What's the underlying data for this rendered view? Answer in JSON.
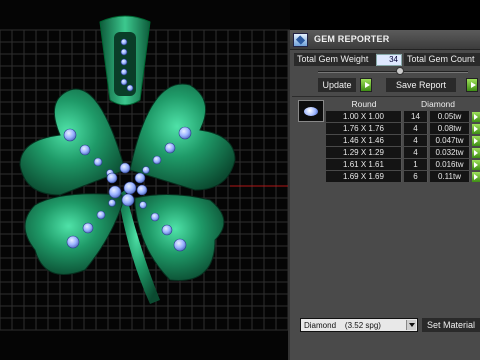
{
  "panel": {
    "title": "GEM REPORTER",
    "total_gem_weight_label": "Total Gem Weight",
    "total_gem_weight_value": "34",
    "total_gem_count_label": "Total Gem Count",
    "update_label": "Update",
    "save_report_label": "Save Report"
  },
  "table": {
    "headers": [
      "Round",
      "Diamond"
    ],
    "rows": [
      {
        "size": "1.00 X 1.00",
        "count": "14",
        "weight": "0.05tw"
      },
      {
        "size": "1.76 X 1.76",
        "count": "4",
        "weight": "0.08tw"
      },
      {
        "size": "1.46 X 1.46",
        "count": "4",
        "weight": "0.047tw"
      },
      {
        "size": "1.29 X 1.29",
        "count": "4",
        "weight": "0.032tw"
      },
      {
        "size": "1.61 X 1.61",
        "count": "1",
        "weight": "0.016tw"
      },
      {
        "size": "1.69 X 1.69",
        "count": "6",
        "weight": "0.11tw"
      }
    ]
  },
  "material": {
    "selected": "Diamond    (3.52 spg)",
    "set_label": "Set Material"
  },
  "colors": {
    "pendant_green": "#1f8f62",
    "gem_blue": "#9ab3ff",
    "grid_line": "#2e2e2e",
    "axis_red": "#b01818",
    "accent_green": "#5fbf24"
  },
  "icons": {
    "panel_logo": "gem-reporter-logo-icon",
    "gem_thumbnail": "round-gem-icon",
    "go": "green-arrow-icon",
    "dropdown": "chevron-down-icon"
  }
}
